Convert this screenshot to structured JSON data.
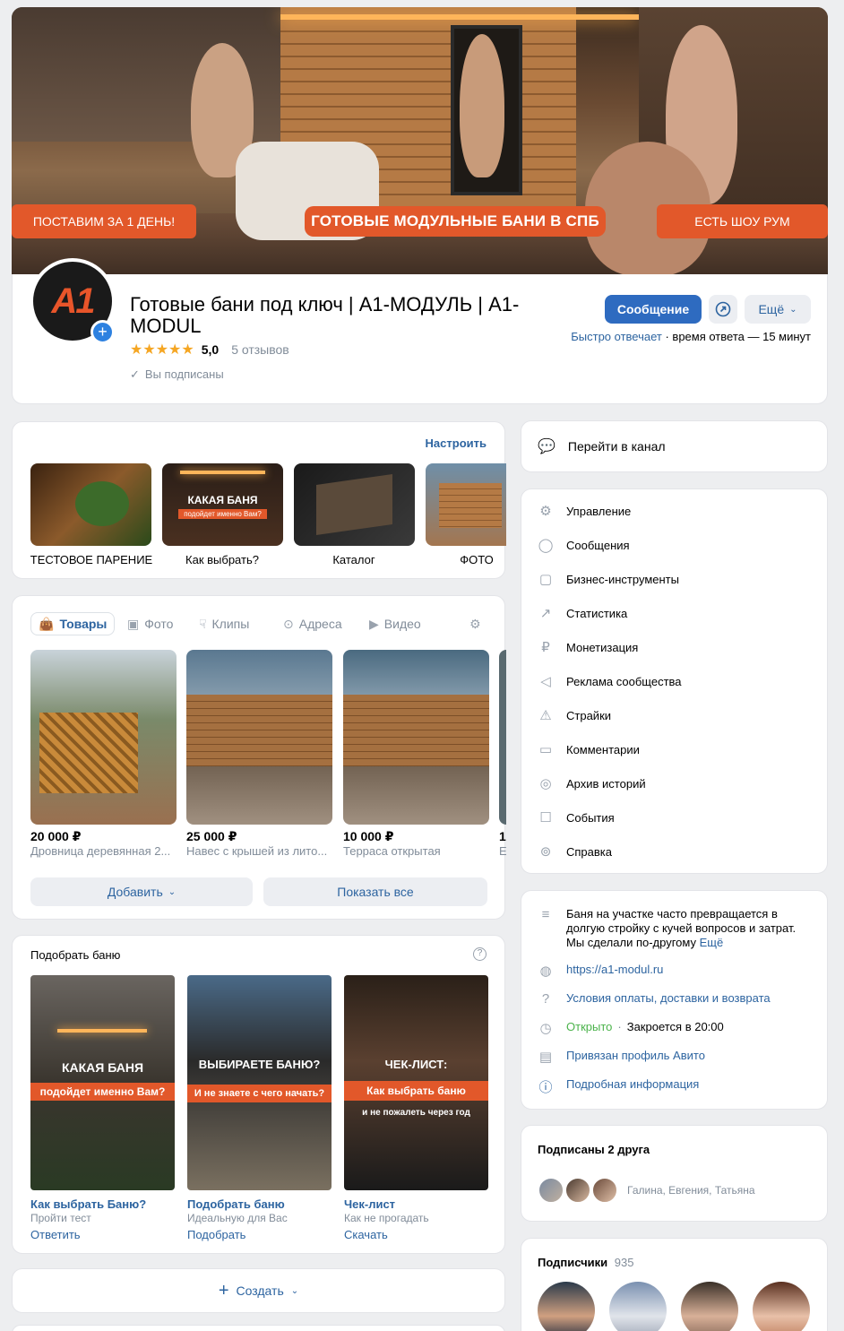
{
  "cover": {
    "banner_left": "ПОСТАВИМ  ЗА 1 ДЕНЬ!",
    "banner_center": "ГОТОВЫЕ МОДУЛЬНЫЕ БАНИ В СПБ",
    "banner_right": "ЕСТЬ ШОУ РУМ"
  },
  "header": {
    "avatar_logo": "A1",
    "title": "Готовые бани под ключ | А1-МОДУЛЬ | А1-MODUL",
    "rating": "5,0",
    "reviews": "5 отзывов",
    "subscribed": "Вы подписаны",
    "message_button": "Сообщение",
    "more_button": "Ещё",
    "reply_fast": "Быстро отвечает",
    "reply_time": " · время ответа — 15 минут"
  },
  "highlights": {
    "settings_link": "Настроить",
    "items": [
      {
        "label": "ТЕСТОВОЕ ПАРЕНИЕ"
      },
      {
        "label": "Как выбрать?",
        "overlay_title": "КАКАЯ БАНЯ",
        "overlay_sub": "подойдет именно Вам?"
      },
      {
        "label": "Каталог"
      },
      {
        "label": "ФОТО"
      }
    ]
  },
  "goods": {
    "tabs": [
      "Товары",
      "Фото",
      "Клипы",
      "Адреса",
      "Видео"
    ],
    "items": [
      {
        "price": "20 000 ₽",
        "title": "Дровница деревянная 2..."
      },
      {
        "price": "25 000 ₽",
        "title": "Навес с крышей из лито..."
      },
      {
        "price": "10 000 ₽",
        "title": "Терраса открытая"
      },
      {
        "price": "1",
        "title": "Е"
      }
    ],
    "add_button": "Добавить",
    "show_all_button": "Показать все"
  },
  "quiz": {
    "title": "Подобрать баню",
    "items": [
      {
        "overlay_title": "КАКАЯ БАНЯ",
        "overlay_sub": "подойдет именно Вам?",
        "title": "Как выбрать Баню?",
        "subtitle": "Пройти тест",
        "action": "Ответить"
      },
      {
        "overlay_title": "ВЫБИРАЕТЕ БАНЮ?",
        "overlay_sub": "И не знаете с чего начать?",
        "title": "Подобрать баню",
        "subtitle": "Идеальную для Вас",
        "action": "Подобрать"
      },
      {
        "overlay_title": "ЧЕК-ЛИСТ:",
        "overlay_sub": "Как выбрать баню",
        "overlay_sub2": "и не пожалеть через год",
        "title": "Чек-лист",
        "subtitle": "Как не прогадать",
        "action": "Скачать"
      }
    ]
  },
  "create_button": "Создать",
  "channel": {
    "label": "Перейти в канал"
  },
  "menu": {
    "items": [
      {
        "label": "Управление",
        "icon": "gear-icon"
      },
      {
        "label": "Сообщения",
        "icon": "chat-icon"
      },
      {
        "label": "Бизнес-инструменты",
        "icon": "bag-icon"
      },
      {
        "label": "Статистика",
        "icon": "chart-icon"
      },
      {
        "label": "Монетизация",
        "icon": "ruble-icon"
      },
      {
        "label": "Реклама сообщества",
        "icon": "megaphone-icon"
      },
      {
        "label": "Страйки",
        "icon": "warning-icon"
      },
      {
        "label": "Комментарии",
        "icon": "comment-icon"
      },
      {
        "label": "Архив историй",
        "icon": "archive-icon"
      },
      {
        "label": "События",
        "icon": "event-icon"
      },
      {
        "label": "Справка",
        "icon": "help-icon"
      }
    ]
  },
  "info": {
    "description": "Баня на участке часто превращается в долгую стройку с кучей вопросов и затрат. Мы сделали по-другому",
    "more": "Ещё",
    "website": "https://a1-modul.ru",
    "terms": "Условия оплаты, доставки и возврата",
    "open_status": "Открыто",
    "closes": "Закроется в 20:00",
    "avito": "Привязан профиль Авито",
    "details": "Подробная информация"
  },
  "friends": {
    "title": "Подписаны 2 друга",
    "names": "Галина, Евгения, Татьяна"
  },
  "subscribers": {
    "title": "Подписчики",
    "count": "935"
  }
}
